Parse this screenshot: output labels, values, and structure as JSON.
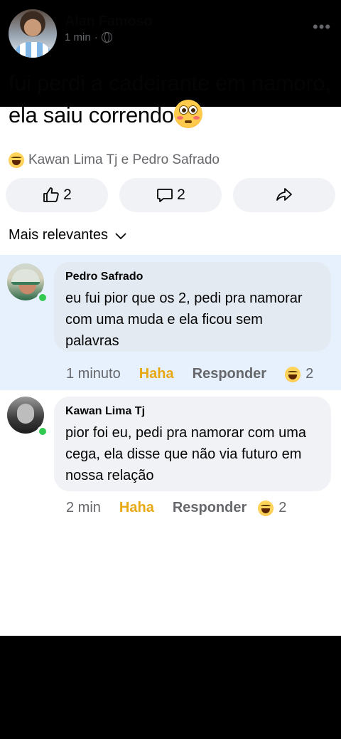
{
  "post": {
    "author": "Alan Famoso",
    "time": "1 min",
    "separator": "·",
    "text": "fui perdi a cadeirante em namoro, ela saiu correndo",
    "reactors": "Kawan Lima Tj e Pedro Safrado",
    "like_count": "2",
    "comment_count": "2"
  },
  "sort_label": "Mais relevantes",
  "comments": [
    {
      "name": "Pedro Safrado",
      "text": "eu fui pior que os 2, pedi pra namorar com uma muda e ela ficou sem palavras",
      "time": "1 minuto",
      "haha": "Haha",
      "reply": "Responder",
      "reaction_count": "2"
    },
    {
      "name": "Kawan Lima Tj",
      "text": "pior foi eu, pedi pra namorar com uma cega, ela disse que não via futuro em nossa relação",
      "time": "2 min",
      "haha": "Haha",
      "reply": "Responder",
      "reaction_count": "2"
    }
  ],
  "icons": {
    "menu": "more-dots-icon",
    "privacy": "globe-icon",
    "like": "thumbs-up-icon",
    "comment": "comment-icon",
    "share": "share-icon",
    "reaction": "haha-reaction-icon",
    "post_emoji": "flushed-emoji-icon"
  },
  "colors": {
    "highlight": "#e7f0fd",
    "online": "#31c950",
    "haha": "#e8a812"
  }
}
